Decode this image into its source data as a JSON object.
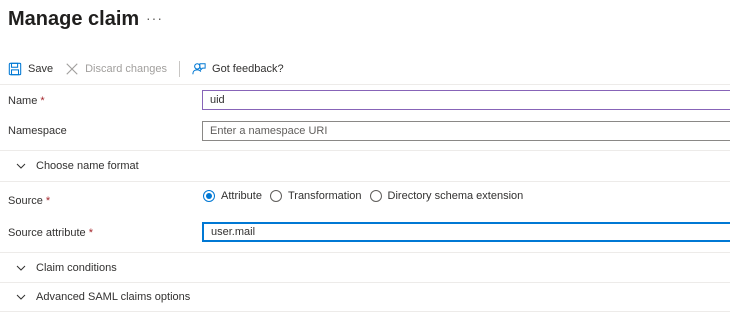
{
  "page": {
    "title": "Manage claim",
    "more_label": "···"
  },
  "toolbar": {
    "save_label": "Save",
    "discard_label": "Discard changes",
    "feedback_label": "Got feedback?"
  },
  "form": {
    "name": {
      "label": "Name",
      "required_mark": "*",
      "value": "uid"
    },
    "namespace": {
      "label": "Namespace",
      "placeholder": "Enter a namespace URI"
    },
    "choose_name_format": {
      "label": "Choose name format"
    },
    "source": {
      "label": "Source",
      "required_mark": "*",
      "options": [
        {
          "label": "Attribute",
          "checked": true
        },
        {
          "label": "Transformation",
          "checked": false
        },
        {
          "label": "Directory schema extension",
          "checked": false
        }
      ]
    },
    "source_attribute": {
      "label": "Source attribute",
      "required_mark": "*",
      "value": "user.mail"
    },
    "claim_conditions": {
      "label": "Claim conditions"
    },
    "advanced_saml": {
      "label": "Advanced SAML claims options"
    }
  },
  "colors": {
    "accent": "#0078d4",
    "required": "#a4262c",
    "disabled": "#a19f9d"
  },
  "icons": {
    "save": "floppy-disk-icon",
    "discard": "close-icon",
    "feedback": "feedback-person-icon",
    "chevron": "chevron-down-icon",
    "more": "ellipsis-icon"
  }
}
